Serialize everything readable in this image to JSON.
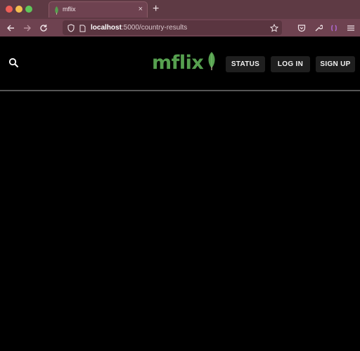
{
  "browser": {
    "tab": {
      "title": "mflix",
      "close": "×"
    },
    "new_tab": "+",
    "url": {
      "host": "localhost",
      "path": ":5000/country-results"
    }
  },
  "header": {
    "logo_text": "mflix",
    "buttons": {
      "status": "STATUS",
      "login": "LOG IN",
      "signup": "SIGN UP"
    }
  },
  "colors": {
    "tabbar": "#5e3a44",
    "toolbar": "#6e4250",
    "brand_green": "#56a04f",
    "page_bg": "#000000",
    "button_bg": "#1f1f1f"
  },
  "icons": [
    "back-icon",
    "forward-icon",
    "reload-icon",
    "shield-icon",
    "page-icon",
    "bookmark-star-icon",
    "pocket-icon",
    "wrench-icon",
    "extension-icon",
    "menu-icon",
    "search-icon",
    "leaf-icon"
  ]
}
